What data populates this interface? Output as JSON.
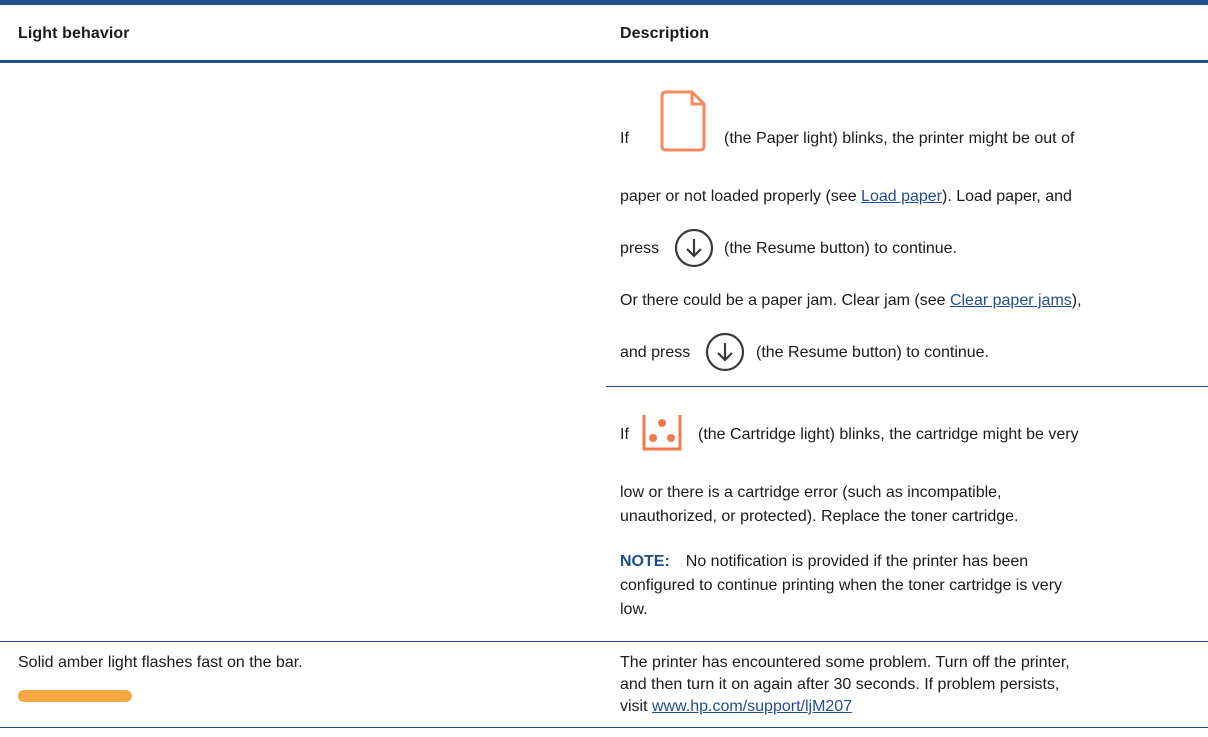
{
  "header": {
    "col1": "Light behavior",
    "col2": "Description"
  },
  "row1": {
    "paper": {
      "l1_prefix": "If",
      "l1_suffix": "(the Paper light) blinks, the printer might be out of",
      "l2_prefix": "paper or not loaded properly (see ",
      "l2_link": "Load paper",
      "l2_suffix": "). Load paper, and",
      "l3_prefix": "press",
      "l3_suffix": "(the Resume button) to continue.",
      "l4_prefix": "Or there could be a paper jam. Clear jam (see ",
      "l4_link": "Clear paper jams",
      "l4_suffix": "),",
      "l5_prefix": "and press",
      "l5_suffix": "(the Resume button) to continue."
    },
    "cartridge": {
      "l1_prefix": "If",
      "l1_suffix": "(the Cartridge light) blinks, the cartridge might be very",
      "l2": "low or there is a cartridge error (such as incompatible,",
      "l3": "unauthorized, or protected). Replace the toner cartridge.",
      "note_label": "NOTE:",
      "note_l1": "No notification is provided if the printer has been",
      "note_l2": "configured to continue printing when the toner cartridge is very",
      "note_l3": "low."
    }
  },
  "row2": {
    "behavior": "Solid amber light flashes fast on the bar.",
    "desc_l1": "The printer has encountered some problem. Turn off the printer,",
    "desc_l2": "and then turn it on again after 30 seconds. If problem persists,",
    "desc_l3_prefix": "visit ",
    "desc_l3_link": "www.hp.com/support/ljM207"
  },
  "icons": {
    "paper_light": "paper-light-icon",
    "resume_button": "resume-button-icon",
    "cartridge_light": "cartridge-light-icon",
    "amber_bar": "amber-light-bar"
  },
  "colors": {
    "rule": "#1f4e8f",
    "link": "#1f4e8f",
    "paper_icon": "#f58a5c",
    "cartridge_icon": "#f07a4e",
    "amber_bar": "#f5a742",
    "resume_icon": "#3a3a3a"
  }
}
